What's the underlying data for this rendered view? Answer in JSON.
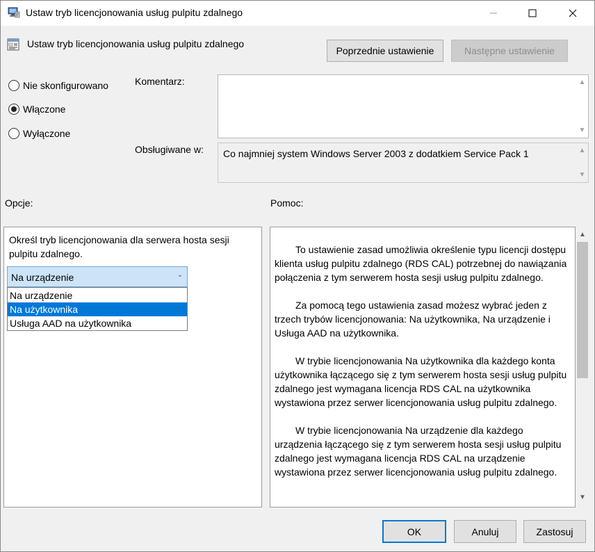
{
  "window": {
    "title": "Ustaw tryb licencjonowania usług pulpitu zdalnego",
    "icon": "computer-policy-icon"
  },
  "header": {
    "policy_title": "Ustaw tryb licencjonowania usług pulpitu zdalnego",
    "prev_button": "Poprzednie ustawienie",
    "next_button": "Następne ustawienie"
  },
  "state": {
    "options": [
      {
        "label": "Nie skonfigurowano",
        "selected": false
      },
      {
        "label": "Włączone",
        "selected": true
      },
      {
        "label": "Wyłączone",
        "selected": false
      }
    ]
  },
  "comment": {
    "label": "Komentarz:",
    "value": ""
  },
  "supported": {
    "label": "Obsługiwane w:",
    "value": "Co najmniej system Windows Server 2003 z dodatkiem Service Pack 1"
  },
  "options_section": {
    "heading": "Opcje:",
    "description": "Określ tryb licencjonowania dla serwera hosta sesji pulpitu zdalnego.",
    "combo_value": "Na urządzenie",
    "dropdown_items": [
      {
        "label": "Na urządzenie",
        "selected": false
      },
      {
        "label": "Na użytkownika",
        "selected": true
      },
      {
        "label": "Usługa AAD na użytkownika",
        "selected": false
      }
    ]
  },
  "help_section": {
    "heading": "Pomoc:",
    "paragraphs": [
      "To ustawienie zasad umożliwia określenie typu licencji dostępu klienta usług pulpitu zdalnego (RDS CAL) potrzebnej do nawiązania połączenia z tym serwerem hosta sesji usług pulpitu zdalnego.",
      "Za pomocą tego ustawienia zasad możesz wybrać jeden z trzech trybów licencjonowania: Na użytkownika, Na urządzenie i Usługa AAD na użytkownika.",
      "W trybie licencjonowania Na użytkownika dla każdego konta użytkownika łączącego się z tym serwerem hosta sesji usług pulpitu zdalnego jest wymagana licencja RDS CAL na użytkownika wystawiona przez serwer licencjonowania usług pulpitu zdalnego.",
      "W trybie licencjonowania Na urządzenie dla każdego urządzenia łączącego się z tym serwerem hosta sesji usług pulpitu zdalnego jest wymagana licencja RDS CAL na urządzenie wystawiona przez serwer licencjonowania usług pulpitu zdalnego."
    ]
  },
  "footer": {
    "ok": "OK",
    "cancel": "Anuluj",
    "apply": "Zastosuj"
  },
  "colors": {
    "accent": "#0078d7",
    "window_bg": "#f0f0f0",
    "combo_bg": "#cce4f7"
  }
}
